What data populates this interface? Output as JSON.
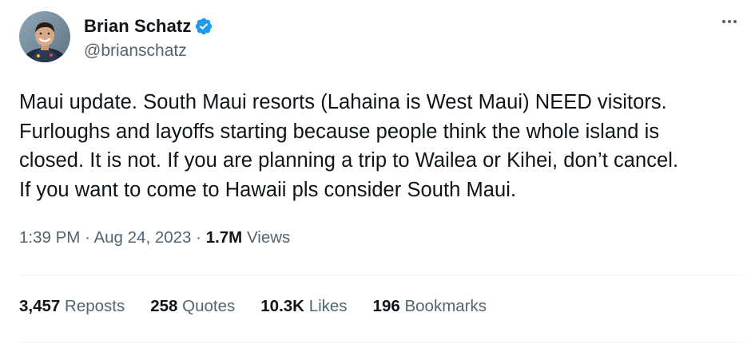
{
  "author": {
    "display_name": "Brian Schatz",
    "handle": "@brianschatz",
    "verified": true,
    "verified_color": "#1d9bf0"
  },
  "menu": {
    "icon": "more-horizontal-icon"
  },
  "tweet": {
    "lines": [
      "Maui update. South Maui resorts (Lahaina is West Maui) NEED visitors.",
      "Furloughs and layoffs starting because people think the whole island is",
      "closed. It is not. If you are planning a trip to Wailea or Kihei, don’t cancel.",
      "If you want to come to Hawaii pls consider South Maui."
    ]
  },
  "meta": {
    "time": "1:39 PM",
    "separator": "·",
    "date": "Aug 24, 2023",
    "views_count": "1.7M",
    "views_label": "Views"
  },
  "stats": {
    "reposts": {
      "count": "3,457",
      "label": "Reposts"
    },
    "quotes": {
      "count": "258",
      "label": "Quotes"
    },
    "likes": {
      "count": "10.3K",
      "label": "Likes"
    },
    "bookmarks": {
      "count": "196",
      "label": "Bookmarks"
    }
  },
  "colors": {
    "text_primary": "#0f1419",
    "text_secondary": "#536471",
    "divider": "#eff3f4"
  }
}
